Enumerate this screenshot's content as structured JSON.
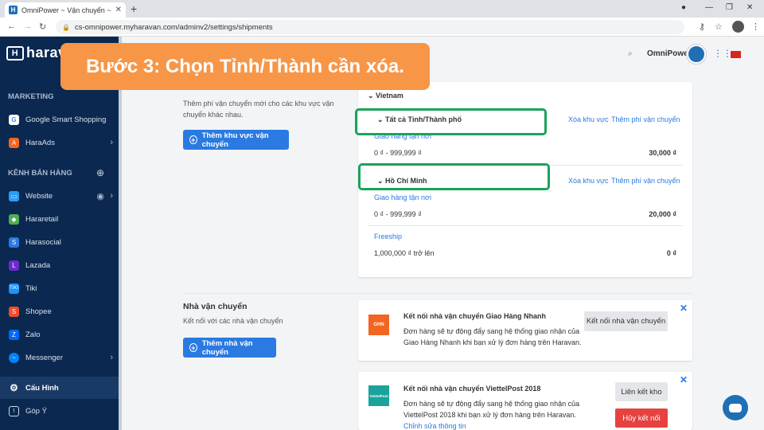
{
  "browser": {
    "tab_title": "OmniPower ~ Vận chuyển ~ Hara",
    "favicon_letter": "H",
    "url": "cs-omnipower.myharavan.com/adminv2/settings/shipments"
  },
  "sidebar": {
    "logo": "harav",
    "sections": {
      "marketing": "MARKETING",
      "channels": "KÊNH BÁN HÀNG"
    },
    "marketing_items": [
      {
        "label": "Google Smart Shopping"
      },
      {
        "label": "HaraAds"
      }
    ],
    "channel_items": [
      {
        "label": "Website"
      },
      {
        "label": "Hararetail"
      },
      {
        "label": "Harasocial"
      },
      {
        "label": "Lazada"
      },
      {
        "label": "Tiki"
      },
      {
        "label": "Shopee"
      },
      {
        "label": "Zalo"
      },
      {
        "label": "Messenger"
      }
    ],
    "settings": "Cấu Hình",
    "feedback": "Góp Ý"
  },
  "header": {
    "store_name": "OmniPower"
  },
  "banner": {
    "text": "Bước 3: Chọn Tỉnh/Thành cần xóa."
  },
  "zones": {
    "desc": "Thêm phí vận chuyển mới cho các khu vực vận chuyển khác nhau.",
    "add_button": "Thêm khu vực vận chuyển",
    "country": "Vietnam",
    "groups": [
      {
        "name": "Tất cả Tỉnh/Thành phố",
        "delete_link": "Xóa khu vực",
        "add_fee_link": "Thêm phí vận chuyển",
        "rates": [
          {
            "name": "Giao hàng tận nơi",
            "range": "0 ₫ - 999,999 ₫",
            "price": "30,000 ₫"
          }
        ]
      },
      {
        "name": "Hồ Chí Minh",
        "delete_link": "Xóa khu vực",
        "add_fee_link": "Thêm phí vận chuyển",
        "rates": [
          {
            "name": "Giao hàng tận nơi",
            "range": "0 ₫ - 999,999 ₫",
            "price": "20,000 ₫"
          },
          {
            "name": "Freeship",
            "range": "1,000,000 ₫ trở lên",
            "price": "0 ₫"
          }
        ]
      }
    ]
  },
  "carriers": {
    "title": "Nhà vận chuyển",
    "desc": "Kết nối với các nhà vận chuyển",
    "add_button": "Thêm nhà vận chuyển",
    "list": [
      {
        "logo_text": "GHN",
        "title": "Kết nối nhà vận chuyển Giao Hàng Nhanh",
        "desc": "Đơn hàng sẽ tự động đẩy sang hệ thống giao nhận của Giao Hàng Nhanh khi bạn xử lý đơn hàng trên Haravan.",
        "button": "Kết nối nhà vận chuyển"
      },
      {
        "logo_text": "ViettelPost",
        "title": "Kết nối nhà vận chuyển ViettelPost 2018",
        "desc": "Đơn hàng sẽ tự động đẩy sang hệ thống giao nhận của ViettelPost 2018 khi bạn xử lý đơn hàng trên Haravan.",
        "button_secondary": "Liên kết kho",
        "button_danger": "Hủy kết nối",
        "edit_link": "Chỉnh sửa thông tin"
      }
    ]
  },
  "colors": {
    "sidebar": "#0b2850",
    "accent": "#2a7ae2",
    "highlight": "#19a45a",
    "banner": "#f79646",
    "danger": "#e64340"
  }
}
